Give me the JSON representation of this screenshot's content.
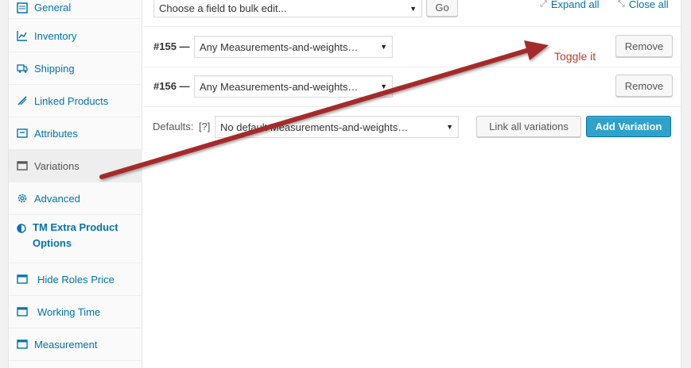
{
  "sidebar": {
    "items": [
      {
        "label": "General",
        "icon": "general-icon"
      },
      {
        "label": "Inventory",
        "icon": "inventory-icon"
      },
      {
        "label": "Shipping",
        "icon": "truck-icon"
      },
      {
        "label": "Linked Products",
        "icon": "link-icon"
      },
      {
        "label": "Attributes",
        "icon": "attributes-icon"
      },
      {
        "label": "Variations",
        "icon": "variations-icon"
      },
      {
        "label": "Advanced",
        "icon": "gear-icon"
      },
      {
        "label": "TM Extra Product Options",
        "icon": "contrast-icon"
      },
      {
        "label": "Hide Roles Price",
        "icon": "window-icon"
      },
      {
        "label": "Working Time",
        "icon": "window-icon"
      },
      {
        "label": "Measurement",
        "icon": "window-icon"
      }
    ],
    "active_index": 5
  },
  "toolbar": {
    "bulk_select": "Choose a field to bulk edit...",
    "go_label": "Go",
    "expand_all": "Expand all",
    "close_all": "Close all"
  },
  "variations": [
    {
      "id": "#155 —",
      "value": "Any Measurements-and-weights…",
      "remove_label": "Remove"
    },
    {
      "id": "#156 —",
      "value": "Any Measurements-and-weights…",
      "remove_label": "Remove"
    }
  ],
  "defaults": {
    "label": "Defaults:",
    "help": "[?]",
    "value": "No default Measurements-and-weights…",
    "link_all_label": "Link all variations",
    "add_variation_label": "Add Variation"
  },
  "annotation": {
    "text": "Toggle it",
    "color": "#b22222"
  },
  "colors": {
    "accent": "#0073aa",
    "primary_button": "#2ea2cc",
    "arrow": "#b22222"
  }
}
